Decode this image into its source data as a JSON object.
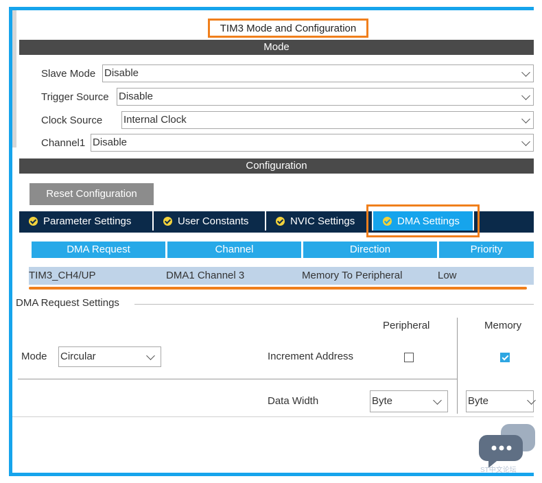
{
  "title": "TIM3 Mode and Configuration",
  "mode_section": {
    "header": "Mode",
    "fields": [
      {
        "label": "Slave Mode",
        "value": "Disable"
      },
      {
        "label": "Trigger Source",
        "value": "Disable"
      },
      {
        "label": "Clock Source",
        "value": "Internal Clock"
      },
      {
        "label": "Channel1",
        "value": "Disable"
      }
    ]
  },
  "config_section": {
    "header": "Configuration",
    "reset_label": "Reset Configuration",
    "tabs": [
      {
        "label": "Parameter Settings"
      },
      {
        "label": "User Constants"
      },
      {
        "label": "NVIC Settings"
      },
      {
        "label": "DMA Settings",
        "active": true
      }
    ]
  },
  "dma_table": {
    "headers": [
      "DMA Request",
      "Channel",
      "Direction",
      "Priority"
    ],
    "rows": [
      [
        "TIM3_CH4/UP",
        "DMA1 Channel 3",
        "Memory To Peripheral",
        "Low"
      ]
    ]
  },
  "dma_request_settings": {
    "label": "DMA Request Settings",
    "peripheral_label": "Peripheral",
    "memory_label": "Memory",
    "mode_label": "Mode",
    "mode_value": "Circular",
    "increment_label": "Increment Address",
    "peripheral_increment": false,
    "memory_increment": true,
    "data_width_label": "Data Width",
    "peripheral_width": "Byte",
    "memory_width": "Byte"
  },
  "colors": {
    "accent_blue": "#16a4ec",
    "highlight_orange": "#f07f1c",
    "section_gray": "#4a4a4a",
    "tab_navy": "#0b2a4a"
  },
  "watermark": "ST中文论坛"
}
